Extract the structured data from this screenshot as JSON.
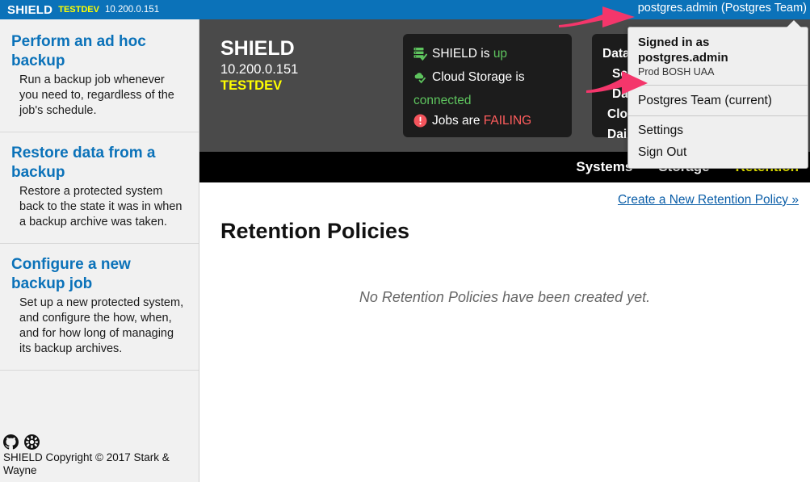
{
  "topbar": {
    "brand": "SHIELD",
    "env": "TESTDEV",
    "address": "10.200.0.151",
    "user_label": "postgres.admin (Postgres Team)"
  },
  "sidebar": {
    "help_items": [
      {
        "title": "Perform an ad hoc backup",
        "desc": "Run a backup job whenever you need to, regardless of the job's schedule."
      },
      {
        "title": "Restore data from a backup",
        "desc": "Restore a protected system back to the state it was in when a backup archive was taken."
      },
      {
        "title": "Configure a new backup job",
        "desc": "Set up a new protected system, and configure the how, when, and for how long of managing its backup archives."
      }
    ],
    "footer": {
      "github_icon": "github-icon",
      "bug_icon": "bug-icon",
      "copyright": "SHIELD Copyright © 2017 Stark & Wayne"
    }
  },
  "hero": {
    "title": "SHIELD",
    "address": "10.200.0.151",
    "env": "TESTDEV",
    "health_card": {
      "lines": [
        {
          "icon": "server-check-icon",
          "prefix": "SHIELD is ",
          "value": "up",
          "state": "ok"
        },
        {
          "icon": "cloud-check-icon",
          "prefix": "Cloud Storage is ",
          "value": "connected",
          "state": "ok"
        },
        {
          "icon": "alert-circle-icon",
          "prefix": "Jobs are ",
          "value": "FAILING",
          "state": "bad"
        }
      ]
    },
    "schedule_card": {
      "lines": [
        "Database",
        "Schedule",
        "Daily",
        "Cloud",
        "Daily"
      ]
    }
  },
  "nav": {
    "items": [
      {
        "label": "Systems",
        "active": false
      },
      {
        "label": "Storage",
        "active": false
      },
      {
        "label": "Retention",
        "active": true
      }
    ]
  },
  "content": {
    "create_link": "Create a New Retention Policy »",
    "page_title": "Retention Policies",
    "empty_message": "No Retention Policies have been created yet."
  },
  "dropdown": {
    "signed_in_as": "Signed in as postgres.admin",
    "tenant_subtitle": "Prod BOSH UAA",
    "current_team": "Postgres Team (current)",
    "settings": "Settings",
    "sign_out": "Sign Out"
  },
  "annotations": {
    "arrow_color": "#f4366b",
    "arrow_top_label": "arrow-pointing-to-user-menu",
    "arrow_mid_label": "arrow-pointing-to-current-team"
  },
  "colors": {
    "topbar_blue": "#0b72b9",
    "accent_yellow": "#ffff00",
    "link_blue": "#0b72b9",
    "hero_gray": "#4a4a4a",
    "card_black": "#1c1c1c",
    "ok_green": "#5ec45e",
    "fail_red": "#ff5d5d"
  }
}
